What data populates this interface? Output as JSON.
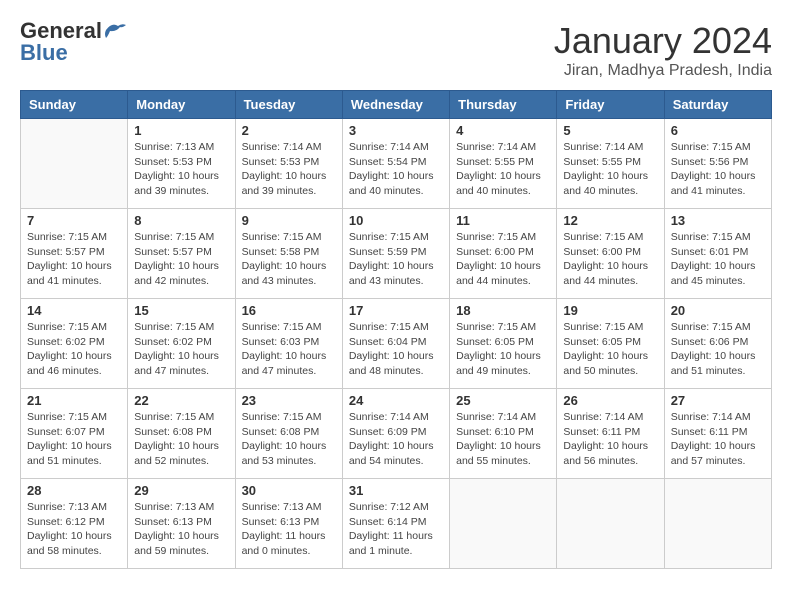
{
  "header": {
    "logo_general": "General",
    "logo_blue": "Blue",
    "title": "January 2024",
    "location": "Jiran, Madhya Pradesh, India"
  },
  "calendar": {
    "headers": [
      "Sunday",
      "Monday",
      "Tuesday",
      "Wednesday",
      "Thursday",
      "Friday",
      "Saturday"
    ],
    "weeks": [
      [
        {
          "num": "",
          "detail": ""
        },
        {
          "num": "1",
          "detail": "Sunrise: 7:13 AM\nSunset: 5:53 PM\nDaylight: 10 hours\nand 39 minutes."
        },
        {
          "num": "2",
          "detail": "Sunrise: 7:14 AM\nSunset: 5:53 PM\nDaylight: 10 hours\nand 39 minutes."
        },
        {
          "num": "3",
          "detail": "Sunrise: 7:14 AM\nSunset: 5:54 PM\nDaylight: 10 hours\nand 40 minutes."
        },
        {
          "num": "4",
          "detail": "Sunrise: 7:14 AM\nSunset: 5:55 PM\nDaylight: 10 hours\nand 40 minutes."
        },
        {
          "num": "5",
          "detail": "Sunrise: 7:14 AM\nSunset: 5:55 PM\nDaylight: 10 hours\nand 40 minutes."
        },
        {
          "num": "6",
          "detail": "Sunrise: 7:15 AM\nSunset: 5:56 PM\nDaylight: 10 hours\nand 41 minutes."
        }
      ],
      [
        {
          "num": "7",
          "detail": "Sunrise: 7:15 AM\nSunset: 5:57 PM\nDaylight: 10 hours\nand 41 minutes."
        },
        {
          "num": "8",
          "detail": "Sunrise: 7:15 AM\nSunset: 5:57 PM\nDaylight: 10 hours\nand 42 minutes."
        },
        {
          "num": "9",
          "detail": "Sunrise: 7:15 AM\nSunset: 5:58 PM\nDaylight: 10 hours\nand 43 minutes."
        },
        {
          "num": "10",
          "detail": "Sunrise: 7:15 AM\nSunset: 5:59 PM\nDaylight: 10 hours\nand 43 minutes."
        },
        {
          "num": "11",
          "detail": "Sunrise: 7:15 AM\nSunset: 6:00 PM\nDaylight: 10 hours\nand 44 minutes."
        },
        {
          "num": "12",
          "detail": "Sunrise: 7:15 AM\nSunset: 6:00 PM\nDaylight: 10 hours\nand 44 minutes."
        },
        {
          "num": "13",
          "detail": "Sunrise: 7:15 AM\nSunset: 6:01 PM\nDaylight: 10 hours\nand 45 minutes."
        }
      ],
      [
        {
          "num": "14",
          "detail": "Sunrise: 7:15 AM\nSunset: 6:02 PM\nDaylight: 10 hours\nand 46 minutes."
        },
        {
          "num": "15",
          "detail": "Sunrise: 7:15 AM\nSunset: 6:02 PM\nDaylight: 10 hours\nand 47 minutes."
        },
        {
          "num": "16",
          "detail": "Sunrise: 7:15 AM\nSunset: 6:03 PM\nDaylight: 10 hours\nand 47 minutes."
        },
        {
          "num": "17",
          "detail": "Sunrise: 7:15 AM\nSunset: 6:04 PM\nDaylight: 10 hours\nand 48 minutes."
        },
        {
          "num": "18",
          "detail": "Sunrise: 7:15 AM\nSunset: 6:05 PM\nDaylight: 10 hours\nand 49 minutes."
        },
        {
          "num": "19",
          "detail": "Sunrise: 7:15 AM\nSunset: 6:05 PM\nDaylight: 10 hours\nand 50 minutes."
        },
        {
          "num": "20",
          "detail": "Sunrise: 7:15 AM\nSunset: 6:06 PM\nDaylight: 10 hours\nand 51 minutes."
        }
      ],
      [
        {
          "num": "21",
          "detail": "Sunrise: 7:15 AM\nSunset: 6:07 PM\nDaylight: 10 hours\nand 51 minutes."
        },
        {
          "num": "22",
          "detail": "Sunrise: 7:15 AM\nSunset: 6:08 PM\nDaylight: 10 hours\nand 52 minutes."
        },
        {
          "num": "23",
          "detail": "Sunrise: 7:15 AM\nSunset: 6:08 PM\nDaylight: 10 hours\nand 53 minutes."
        },
        {
          "num": "24",
          "detail": "Sunrise: 7:14 AM\nSunset: 6:09 PM\nDaylight: 10 hours\nand 54 minutes."
        },
        {
          "num": "25",
          "detail": "Sunrise: 7:14 AM\nSunset: 6:10 PM\nDaylight: 10 hours\nand 55 minutes."
        },
        {
          "num": "26",
          "detail": "Sunrise: 7:14 AM\nSunset: 6:11 PM\nDaylight: 10 hours\nand 56 minutes."
        },
        {
          "num": "27",
          "detail": "Sunrise: 7:14 AM\nSunset: 6:11 PM\nDaylight: 10 hours\nand 57 minutes."
        }
      ],
      [
        {
          "num": "28",
          "detail": "Sunrise: 7:13 AM\nSunset: 6:12 PM\nDaylight: 10 hours\nand 58 minutes."
        },
        {
          "num": "29",
          "detail": "Sunrise: 7:13 AM\nSunset: 6:13 PM\nDaylight: 10 hours\nand 59 minutes."
        },
        {
          "num": "30",
          "detail": "Sunrise: 7:13 AM\nSunset: 6:13 PM\nDaylight: 11 hours\nand 0 minutes."
        },
        {
          "num": "31",
          "detail": "Sunrise: 7:12 AM\nSunset: 6:14 PM\nDaylight: 11 hours\nand 1 minute."
        },
        {
          "num": "",
          "detail": ""
        },
        {
          "num": "",
          "detail": ""
        },
        {
          "num": "",
          "detail": ""
        }
      ]
    ]
  }
}
